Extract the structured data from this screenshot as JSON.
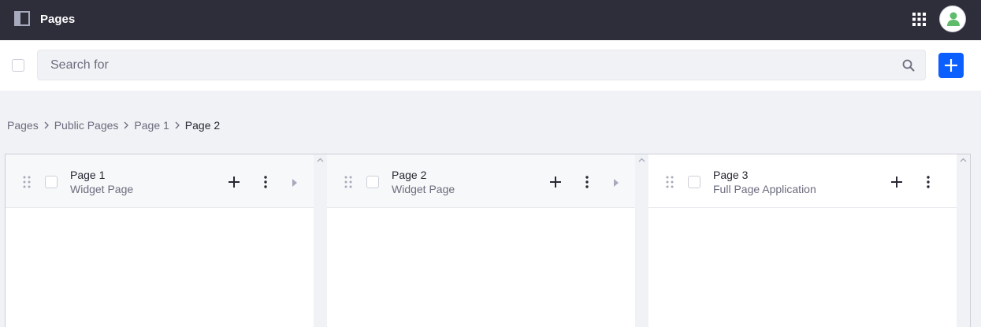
{
  "header": {
    "title": "Pages",
    "sidebar_toggle_icon": "sidebar-toggle-icon",
    "apps_icon": "apps-grid-icon",
    "avatar_icon": "user-icon",
    "avatar_color": "#5ebc6b",
    "background_color": "#2d2e3a"
  },
  "toolbar": {
    "search_placeholder": "Search for",
    "search_value": "",
    "search_icon": "search-icon",
    "add_icon": "plus-icon",
    "accent_color": "#0b5fff"
  },
  "breadcrumb": {
    "items": [
      "Pages",
      "Public Pages",
      "Page 1"
    ],
    "current": "Page 2"
  },
  "columns": [
    {
      "title": "Page 1",
      "type": "Widget Page",
      "has_children": true
    },
    {
      "title": "Page 2",
      "type": "Widget Page",
      "has_children": true
    },
    {
      "title": "Page 3",
      "type": "Full Page Application",
      "has_children": false
    }
  ]
}
